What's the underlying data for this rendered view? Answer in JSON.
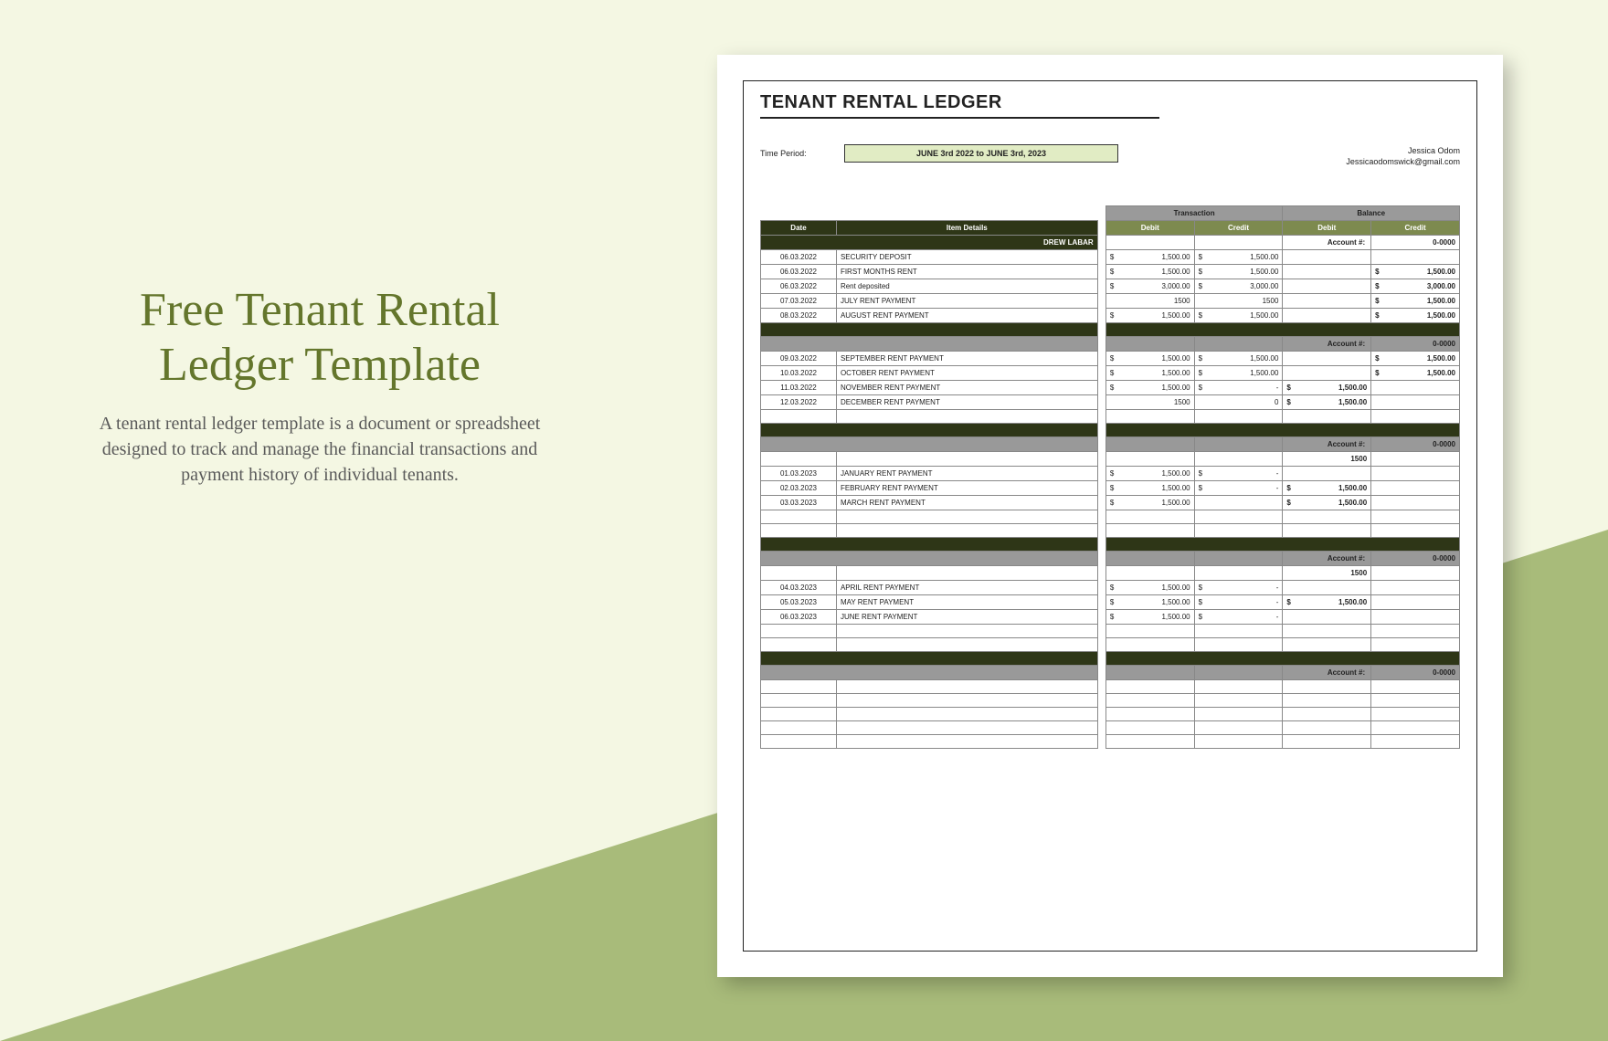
{
  "page": {
    "title": "Free Tenant Rental Ledger Template",
    "description": "A tenant rental ledger template is a document or spreadsheet designed to track and manage the financial transactions and payment history of individual tenants."
  },
  "doc": {
    "title": "TENANT RENTAL LEDGER",
    "time_period_label": "Time Period:",
    "time_period_value": "JUNE 3rd 2022 to JUNE 3rd, 2023",
    "contact_name": "Jessica Odom",
    "contact_email": "Jessicaodomswick@gmail.com",
    "headers": {
      "date": "Date",
      "item": "Item Details",
      "transaction": "Transaction",
      "balance": "Balance",
      "debit": "Debit",
      "credit": "Credit",
      "account": "Account #:",
      "account_num": "0-0000",
      "drew": "DREW LABAR"
    },
    "rows1": [
      {
        "date": "06.03.2022",
        "item": "SECURITY DEPOSIT",
        "td": "$",
        "tdv": "1,500.00",
        "tc": "$",
        "tcv": "1,500.00",
        "bd": "",
        "bdv": "",
        "bc": "",
        "bcv": ""
      },
      {
        "date": "06.03.2022",
        "item": "FIRST MONTHS RENT",
        "td": "$",
        "tdv": "1,500.00",
        "tc": "$",
        "tcv": "1,500.00",
        "bd": "",
        "bdv": "",
        "bc": "$",
        "bcv": "1,500.00"
      },
      {
        "date": "06.03.2022",
        "item": "Rent deposited",
        "td": "$",
        "tdv": "3,000.00",
        "tc": "$",
        "tcv": "3,000.00",
        "bd": "",
        "bdv": "",
        "bc": "$",
        "bcv": "3,000.00"
      },
      {
        "date": "07.03.2022",
        "item": "JULY RENT PAYMENT",
        "td": "",
        "tdv": "1500",
        "tc": "",
        "tcv": "1500",
        "bd": "",
        "bdv": "",
        "bc": "$",
        "bcv": "1,500.00"
      },
      {
        "date": "08.03.2022",
        "item": "AUGUST RENT PAYMENT",
        "td": "$",
        "tdv": "1,500.00",
        "tc": "$",
        "tcv": "1,500.00",
        "bd": "",
        "bdv": "",
        "bc": "$",
        "bcv": "1,500.00"
      }
    ],
    "rows2": [
      {
        "date": "09.03.2022",
        "item": "SEPTEMBER RENT PAYMENT",
        "td": "$",
        "tdv": "1,500.00",
        "tc": "$",
        "tcv": "1,500.00",
        "bd": "",
        "bdv": "",
        "bc": "$",
        "bcv": "1,500.00"
      },
      {
        "date": "10.03.2022",
        "item": "OCTOBER RENT PAYMENT",
        "td": "$",
        "tdv": "1,500.00",
        "tc": "$",
        "tcv": "1,500.00",
        "bd": "",
        "bdv": "",
        "bc": "$",
        "bcv": "1,500.00"
      },
      {
        "date": "11.03.2022",
        "item": "NOVEMBER RENT PAYMENT",
        "td": "$",
        "tdv": "1,500.00",
        "tc": "$",
        "tcv": "-",
        "bd": "$",
        "bdv": "1,500.00",
        "bc": "",
        "bcv": ""
      },
      {
        "date": "12.03.2022",
        "item": "DECEMBER RENT PAYMENT",
        "td": "",
        "tdv": "1500",
        "tc": "",
        "tcv": "0",
        "bd": "$",
        "bdv": "1,500.00",
        "bc": "",
        "bcv": ""
      }
    ],
    "rows3_extra": "1500",
    "rows3": [
      {
        "date": "01.03.2023",
        "item": "JANUARY RENT PAYMENT",
        "td": "$",
        "tdv": "1,500.00",
        "tc": "$",
        "tcv": "-",
        "bd": "",
        "bdv": "",
        "bc": "",
        "bcv": ""
      },
      {
        "date": "02.03.2023",
        "item": "FEBRUARY RENT PAYMENT",
        "td": "$",
        "tdv": "1,500.00",
        "tc": "$",
        "tcv": "-",
        "bd": "$",
        "bdv": "1,500.00",
        "bc": "",
        "bcv": ""
      },
      {
        "date": "03.03.2023",
        "item": "MARCH RENT PAYMENT",
        "td": "$",
        "tdv": "1,500.00",
        "tc": "",
        "tcv": "",
        "bd": "$",
        "bdv": "1,500.00",
        "bc": "",
        "bcv": ""
      }
    ],
    "rows4_extra": "1500",
    "rows4": [
      {
        "date": "04.03.2023",
        "item": "APRIL RENT PAYMENT",
        "td": "$",
        "tdv": "1,500.00",
        "tc": "$",
        "tcv": "-",
        "bd": "",
        "bdv": "",
        "bc": "",
        "bcv": ""
      },
      {
        "date": "05.03.2023",
        "item": "MAY RENT PAYMENT",
        "td": "$",
        "tdv": "1,500.00",
        "tc": "$",
        "tcv": "-",
        "bd": "$",
        "bdv": "1,500.00",
        "bc": "",
        "bcv": ""
      },
      {
        "date": "06.03.2023",
        "item": "JUNE RENT PAYMENT",
        "td": "$",
        "tdv": "1,500.00",
        "tc": "$",
        "tcv": "-",
        "bd": "",
        "bdv": "",
        "bc": "",
        "bcv": ""
      }
    ]
  }
}
